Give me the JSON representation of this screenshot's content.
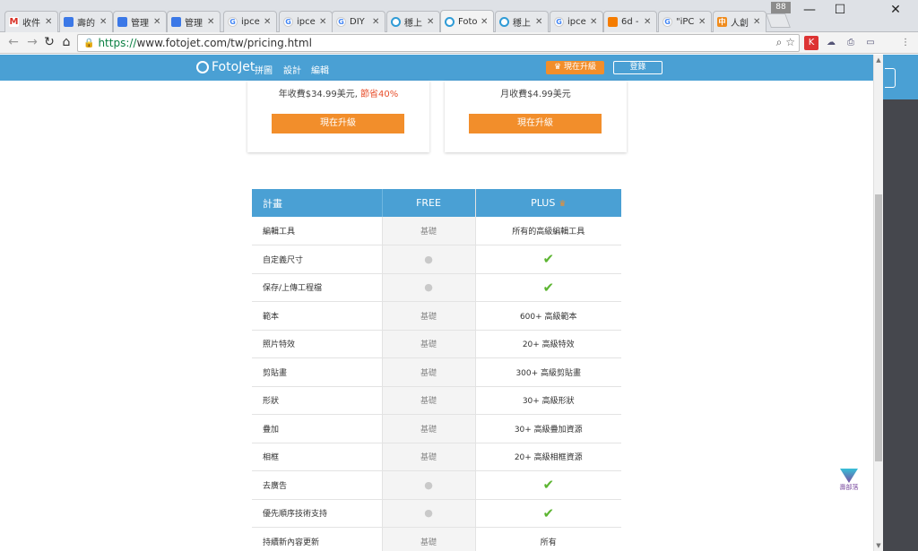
{
  "tabs": [
    {
      "title": "收件",
      "favicon": "gmail-icon",
      "fav": "M",
      "cls": "fav-gmail"
    },
    {
      "title": "壽的",
      "favicon": "doc-icon",
      "fav": "",
      "cls": "fav-blue"
    },
    {
      "title": "管理",
      "favicon": "doc-icon",
      "fav": "",
      "cls": "fav-blue"
    },
    {
      "title": "管理",
      "favicon": "doc-icon",
      "fav": "",
      "cls": "fav-blue"
    },
    {
      "title": "ipce",
      "favicon": "google-icon",
      "fav": "G",
      "cls": "fav-g"
    },
    {
      "title": "ipce",
      "favicon": "google-icon",
      "fav": "G",
      "cls": "fav-g"
    },
    {
      "title": "DIY",
      "favicon": "google-icon",
      "fav": "G",
      "cls": "fav-g"
    },
    {
      "title": "穩上",
      "favicon": "swirl-icon",
      "fav": "",
      "cls": "fav-swirl"
    },
    {
      "title": "Foto",
      "favicon": "swirl-icon",
      "fav": "",
      "cls": "fav-swirl",
      "active": true
    },
    {
      "title": "穩上",
      "favicon": "swirl-icon",
      "fav": "",
      "cls": "fav-swirl"
    },
    {
      "title": "ipce",
      "favicon": "google-icon",
      "fav": "G",
      "cls": "fav-g"
    },
    {
      "title": "6d -",
      "favicon": "orange-icon",
      "fav": "",
      "cls": "fav-orange"
    },
    {
      "title": "\"iPC",
      "favicon": "google-icon",
      "fav": "G",
      "cls": "fav-g"
    },
    {
      "title": "人創",
      "favicon": "zh-icon",
      "fav": "中",
      "cls": "fav-zh"
    }
  ],
  "profile_badge": "88",
  "window_controls": {
    "minimize": "—",
    "maximize": "☐",
    "close": "✕"
  },
  "address": {
    "scheme": "https://",
    "rest": "www.fotojet.com/tw/pricing.html"
  },
  "site": {
    "logo": "FotoJet",
    "nav": [
      "拼圖",
      "設計",
      "編輯"
    ],
    "upgrade_btn": "♛ 現在升級",
    "login_btn": "登錄"
  },
  "cards": [
    {
      "price": "年收費$34.99美元, ",
      "save": "節省40%",
      "button": "現在升級"
    },
    {
      "price": "月收費$4.99美元",
      "save": "",
      "button": "現在升級"
    }
  ],
  "table": {
    "headers": [
      "計畫",
      "FREE",
      "PLUS"
    ],
    "rows": [
      [
        "編輯工具",
        "基礎",
        "所有的高級編輯工具"
      ],
      [
        "自定義尺寸",
        "dot",
        "check"
      ],
      [
        "保存/上傳工程檔",
        "dot",
        "check"
      ],
      [
        "範本",
        "基礎",
        "600+ 高級範本"
      ],
      [
        "照片特效",
        "基礎",
        "20+ 高級特效"
      ],
      [
        "剪貼畫",
        "基礎",
        "300+ 高級剪貼畫"
      ],
      [
        "形狀",
        "基礎",
        "30+ 高級形狀"
      ],
      [
        "疊加",
        "基礎",
        "30+ 高級疊加資源"
      ],
      [
        "相框",
        "基礎",
        "20+ 高級相框資源"
      ],
      [
        "去廣告",
        "dot",
        "check"
      ],
      [
        "優先順序技術支持",
        "dot",
        "check"
      ],
      [
        "持續新內容更新",
        "基礎",
        "所有"
      ]
    ]
  },
  "watermark": "壽部落",
  "colors": {
    "brand_blue": "#4aa0d4",
    "accent_orange": "#f28e2b",
    "check_green": "#5cb531"
  }
}
